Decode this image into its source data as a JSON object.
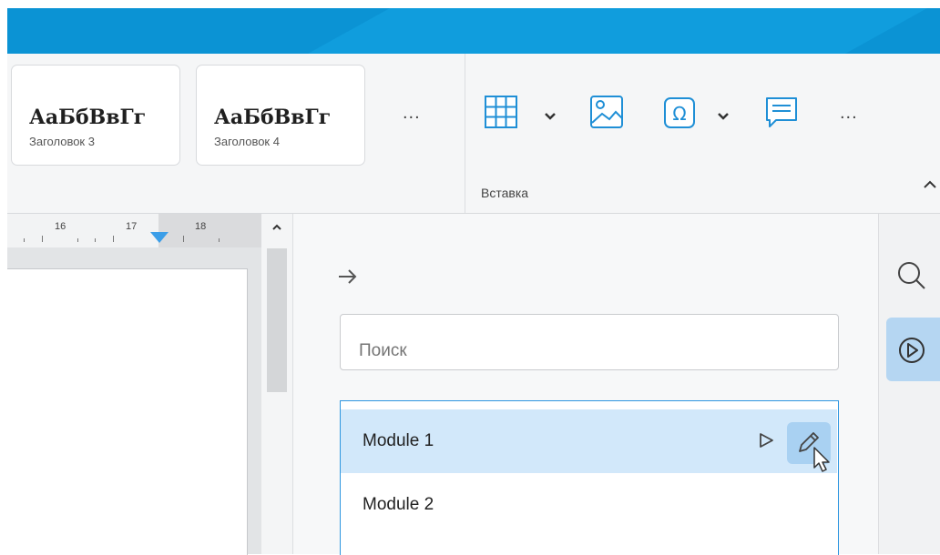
{
  "ribbon": {
    "styles": [
      {
        "sample": "АаБбВвГг",
        "name": "Заголовок 3"
      },
      {
        "sample": "АаБбВвГг",
        "name": "Заголовок 4"
      }
    ],
    "styles_more": "...",
    "insert_more": "...",
    "group_label": "Вставка",
    "tools": [
      "table-icon",
      "image-icon",
      "special-character-icon",
      "comment-icon"
    ]
  },
  "ruler": {
    "numbers": [
      "16",
      "17",
      "18"
    ]
  },
  "panel": {
    "search_placeholder": "Поиск",
    "macros": [
      {
        "label": "Module 1",
        "selected": true
      },
      {
        "label": "Module 2",
        "selected": false
      }
    ]
  },
  "colors": {
    "title_bar": "#0b93d4",
    "accent": "#2d96e0",
    "selection": "#d2e8fa",
    "active_button": "#a9d1f2"
  }
}
